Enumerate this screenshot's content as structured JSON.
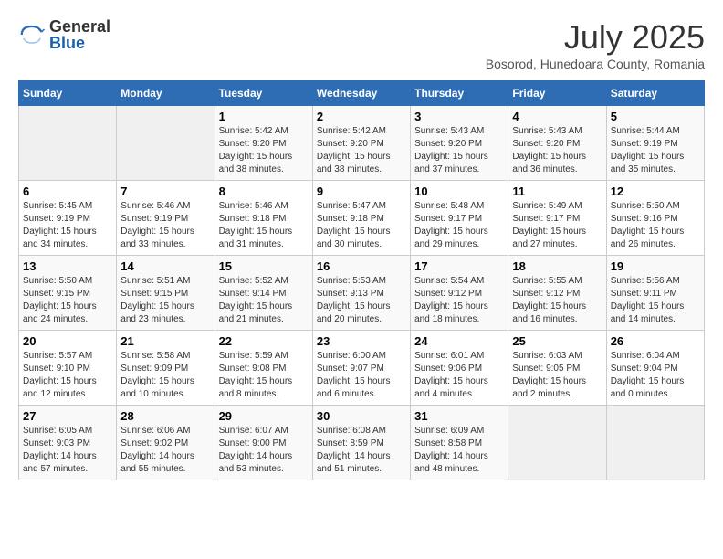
{
  "header": {
    "logo": {
      "general": "General",
      "blue": "Blue"
    },
    "title": "July 2025",
    "location": "Bosorod, Hunedoara County, Romania"
  },
  "weekdays": [
    "Sunday",
    "Monday",
    "Tuesday",
    "Wednesday",
    "Thursday",
    "Friday",
    "Saturday"
  ],
  "weeks": [
    [
      {
        "day": null
      },
      {
        "day": null
      },
      {
        "day": "1",
        "sunrise": "5:42 AM",
        "sunset": "9:20 PM",
        "daylight": "15 hours and 38 minutes."
      },
      {
        "day": "2",
        "sunrise": "5:42 AM",
        "sunset": "9:20 PM",
        "daylight": "15 hours and 38 minutes."
      },
      {
        "day": "3",
        "sunrise": "5:43 AM",
        "sunset": "9:20 PM",
        "daylight": "15 hours and 37 minutes."
      },
      {
        "day": "4",
        "sunrise": "5:43 AM",
        "sunset": "9:20 PM",
        "daylight": "15 hours and 36 minutes."
      },
      {
        "day": "5",
        "sunrise": "5:44 AM",
        "sunset": "9:19 PM",
        "daylight": "15 hours and 35 minutes."
      }
    ],
    [
      {
        "day": "6",
        "sunrise": "5:45 AM",
        "sunset": "9:19 PM",
        "daylight": "15 hours and 34 minutes."
      },
      {
        "day": "7",
        "sunrise": "5:46 AM",
        "sunset": "9:19 PM",
        "daylight": "15 hours and 33 minutes."
      },
      {
        "day": "8",
        "sunrise": "5:46 AM",
        "sunset": "9:18 PM",
        "daylight": "15 hours and 31 minutes."
      },
      {
        "day": "9",
        "sunrise": "5:47 AM",
        "sunset": "9:18 PM",
        "daylight": "15 hours and 30 minutes."
      },
      {
        "day": "10",
        "sunrise": "5:48 AM",
        "sunset": "9:17 PM",
        "daylight": "15 hours and 29 minutes."
      },
      {
        "day": "11",
        "sunrise": "5:49 AM",
        "sunset": "9:17 PM",
        "daylight": "15 hours and 27 minutes."
      },
      {
        "day": "12",
        "sunrise": "5:50 AM",
        "sunset": "9:16 PM",
        "daylight": "15 hours and 26 minutes."
      }
    ],
    [
      {
        "day": "13",
        "sunrise": "5:50 AM",
        "sunset": "9:15 PM",
        "daylight": "15 hours and 24 minutes."
      },
      {
        "day": "14",
        "sunrise": "5:51 AM",
        "sunset": "9:15 PM",
        "daylight": "15 hours and 23 minutes."
      },
      {
        "day": "15",
        "sunrise": "5:52 AM",
        "sunset": "9:14 PM",
        "daylight": "15 hours and 21 minutes."
      },
      {
        "day": "16",
        "sunrise": "5:53 AM",
        "sunset": "9:13 PM",
        "daylight": "15 hours and 20 minutes."
      },
      {
        "day": "17",
        "sunrise": "5:54 AM",
        "sunset": "9:12 PM",
        "daylight": "15 hours and 18 minutes."
      },
      {
        "day": "18",
        "sunrise": "5:55 AM",
        "sunset": "9:12 PM",
        "daylight": "15 hours and 16 minutes."
      },
      {
        "day": "19",
        "sunrise": "5:56 AM",
        "sunset": "9:11 PM",
        "daylight": "15 hours and 14 minutes."
      }
    ],
    [
      {
        "day": "20",
        "sunrise": "5:57 AM",
        "sunset": "9:10 PM",
        "daylight": "15 hours and 12 minutes."
      },
      {
        "day": "21",
        "sunrise": "5:58 AM",
        "sunset": "9:09 PM",
        "daylight": "15 hours and 10 minutes."
      },
      {
        "day": "22",
        "sunrise": "5:59 AM",
        "sunset": "9:08 PM",
        "daylight": "15 hours and 8 minutes."
      },
      {
        "day": "23",
        "sunrise": "6:00 AM",
        "sunset": "9:07 PM",
        "daylight": "15 hours and 6 minutes."
      },
      {
        "day": "24",
        "sunrise": "6:01 AM",
        "sunset": "9:06 PM",
        "daylight": "15 hours and 4 minutes."
      },
      {
        "day": "25",
        "sunrise": "6:03 AM",
        "sunset": "9:05 PM",
        "daylight": "15 hours and 2 minutes."
      },
      {
        "day": "26",
        "sunrise": "6:04 AM",
        "sunset": "9:04 PM",
        "daylight": "15 hours and 0 minutes."
      }
    ],
    [
      {
        "day": "27",
        "sunrise": "6:05 AM",
        "sunset": "9:03 PM",
        "daylight": "14 hours and 57 minutes."
      },
      {
        "day": "28",
        "sunrise": "6:06 AM",
        "sunset": "9:02 PM",
        "daylight": "14 hours and 55 minutes."
      },
      {
        "day": "29",
        "sunrise": "6:07 AM",
        "sunset": "9:00 PM",
        "daylight": "14 hours and 53 minutes."
      },
      {
        "day": "30",
        "sunrise": "6:08 AM",
        "sunset": "8:59 PM",
        "daylight": "14 hours and 51 minutes."
      },
      {
        "day": "31",
        "sunrise": "6:09 AM",
        "sunset": "8:58 PM",
        "daylight": "14 hours and 48 minutes."
      },
      {
        "day": null
      },
      {
        "day": null
      }
    ]
  ],
  "labels": {
    "sunrise": "Sunrise:",
    "sunset": "Sunset:",
    "daylight": "Daylight:"
  }
}
